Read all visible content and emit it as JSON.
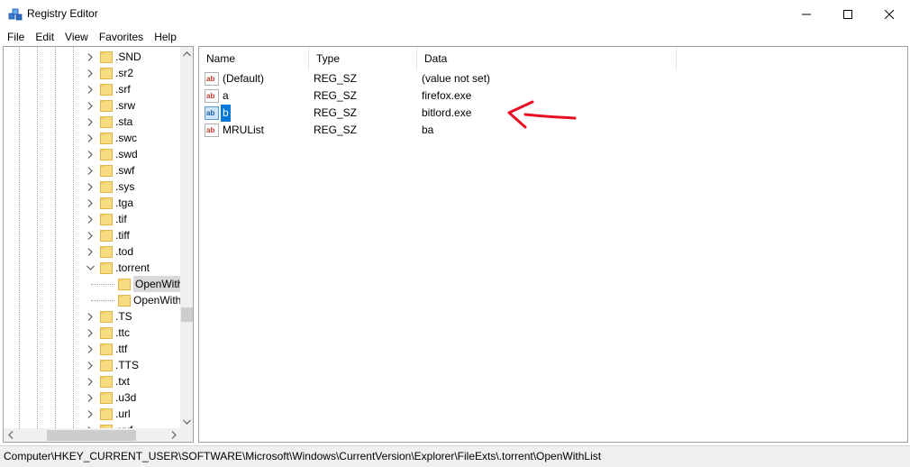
{
  "window": {
    "title": "Registry Editor"
  },
  "menu": [
    "File",
    "Edit",
    "View",
    "Favorites",
    "Help"
  ],
  "tree": {
    "items": [
      {
        "label": ".SND",
        "expanded": false,
        "level": 0
      },
      {
        "label": ".sr2",
        "expanded": false,
        "level": 0
      },
      {
        "label": ".srf",
        "expanded": false,
        "level": 0
      },
      {
        "label": ".srw",
        "expanded": false,
        "level": 0
      },
      {
        "label": ".sta",
        "expanded": false,
        "level": 0
      },
      {
        "label": ".swc",
        "expanded": false,
        "level": 0
      },
      {
        "label": ".swd",
        "expanded": false,
        "level": 0
      },
      {
        "label": ".swf",
        "expanded": false,
        "level": 0
      },
      {
        "label": ".sys",
        "expanded": false,
        "level": 0
      },
      {
        "label": ".tga",
        "expanded": false,
        "level": 0
      },
      {
        "label": ".tif",
        "expanded": false,
        "level": 0
      },
      {
        "label": ".tiff",
        "expanded": false,
        "level": 0
      },
      {
        "label": ".tod",
        "expanded": false,
        "level": 0
      },
      {
        "label": ".torrent",
        "expanded": true,
        "level": 0
      },
      {
        "label": "OpenWith",
        "level": 1,
        "selected": true
      },
      {
        "label": "OpenWith",
        "level": 1
      },
      {
        "label": ".TS",
        "expanded": false,
        "level": 0
      },
      {
        "label": ".ttc",
        "expanded": false,
        "level": 0
      },
      {
        "label": ".ttf",
        "expanded": false,
        "level": 0
      },
      {
        "label": ".TTS",
        "expanded": false,
        "level": 0
      },
      {
        "label": ".txt",
        "expanded": false,
        "level": 0
      },
      {
        "label": ".u3d",
        "expanded": false,
        "level": 0
      },
      {
        "label": ".url",
        "expanded": false,
        "level": 0
      },
      {
        "label": ".uxf",
        "expanded": false,
        "level": 0
      }
    ]
  },
  "values": {
    "columns": [
      "Name",
      "Type",
      "Data"
    ],
    "rows": [
      {
        "name": "(Default)",
        "type": "REG_SZ",
        "data": "(value not set)"
      },
      {
        "name": "a",
        "type": "REG_SZ",
        "data": "firefox.exe"
      },
      {
        "name": "b",
        "type": "REG_SZ",
        "data": "bitlord.exe",
        "selected": true
      },
      {
        "name": "MRUList",
        "type": "REG_SZ",
        "data": "ba"
      }
    ]
  },
  "status": {
    "path": "Computer\\HKEY_CURRENT_USER\\SOFTWARE\\Microsoft\\Windows\\CurrentVersion\\Explorer\\FileExts\\.torrent\\OpenWithList"
  },
  "colors": {
    "selection": "#0078d7",
    "folder": "#f5d87a",
    "annotation": "#e81123"
  },
  "icons": {
    "app": "registry-icon",
    "string_value": "reg-sz-icon",
    "folder": "folder-icon"
  }
}
